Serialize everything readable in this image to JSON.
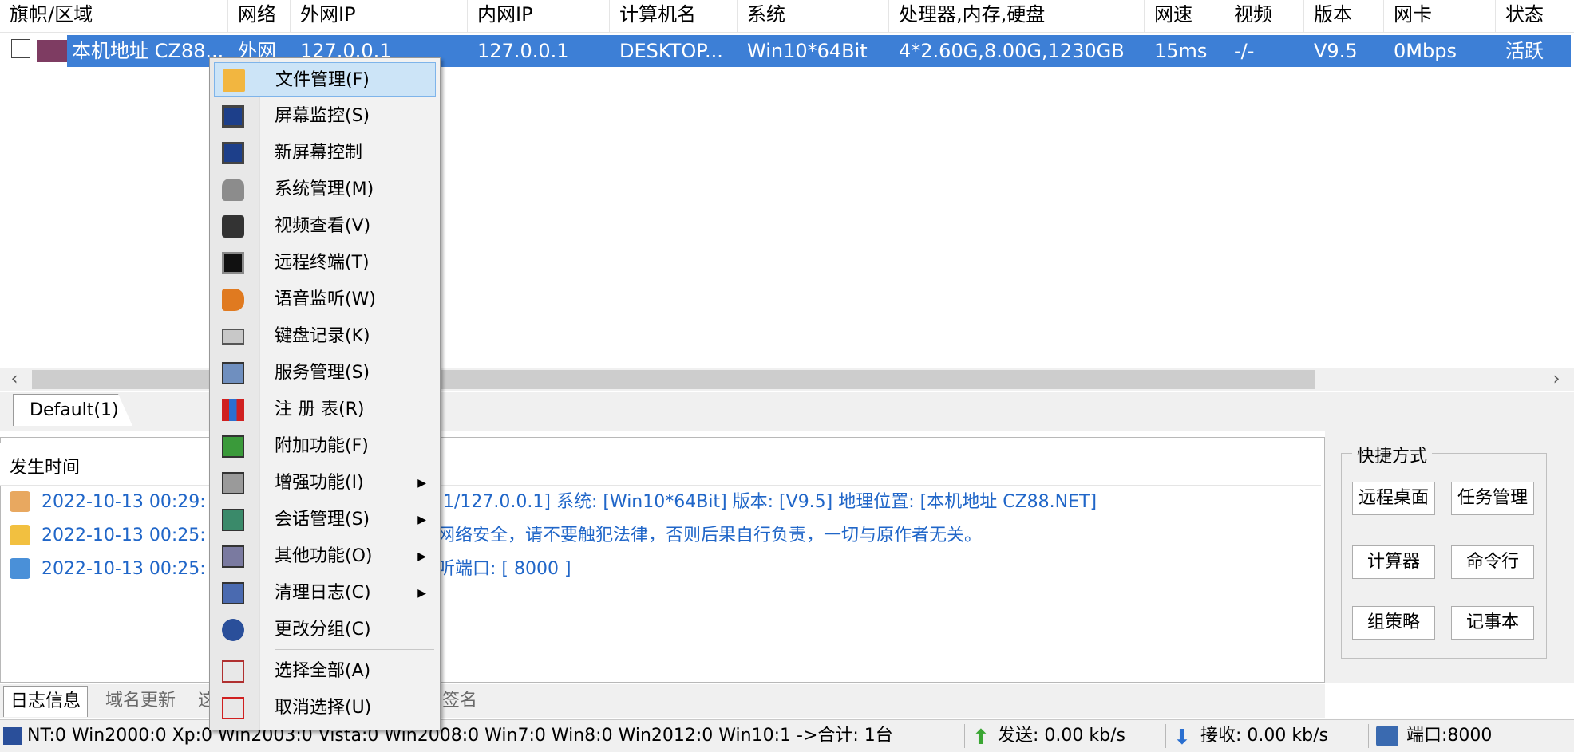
{
  "list": {
    "columns": [
      "旗帜/区域",
      "网络",
      "外网IP",
      "内网IP",
      "计算机名",
      "系统",
      "处理器,内存,硬盘",
      "网速",
      "视频",
      "版本",
      "网卡",
      "状态"
    ],
    "row": {
      "area": "本机地址  CZ88...",
      "network": "外网",
      "wan_ip": "127.0.0.1",
      "lan_ip": "127.0.0.1",
      "computer_name": "DESKTOP...",
      "os": "Win10*64Bit",
      "hardware": "4*2.60G,8.00G,1230GB",
      "speed": "15ms",
      "video": "-/-",
      "version": "V9.5",
      "nic": "0Mbps",
      "status": "活跃"
    }
  },
  "group_tab": "Default(1)",
  "log": {
    "header": "发生时间",
    "rows": [
      {
        "time": "2022-10-13 00:29:",
        "message": ".1/127.0.0.1]   系统: [Win10*64Bit]   版本: [V9.5]   地理位置: [本机地址  CZ88.NET]"
      },
      {
        "time": "2022-10-13 00:25:",
        "message": "网络安全，请不要触犯法律，否则后果自行负责，一切与原作者无关。"
      },
      {
        "time": "2022-10-13 00:25:",
        "message": "听端口: [ 8000 ]"
      }
    ]
  },
  "bottom_tabs": [
    "日志信息",
    "域名更新",
    "这",
    "签名"
  ],
  "shortcuts": {
    "title": "快捷方式",
    "buttons": [
      "远程桌面",
      "任务管理",
      "计算器",
      "命令行",
      "组策略",
      "记事本"
    ]
  },
  "statusbar": {
    "os_counts": "NT:0 Win2000:0 Xp:0 Win2003:0 Vista:0 Win2008:0 Win7:0 Win8:0 Win2012:0 Win10:1 ->合计: 1台",
    "send": "发送: 0.00 kb/s",
    "recv": "接收: 0.00 kb/s",
    "port": "端口:8000"
  },
  "context_menu": {
    "items": [
      {
        "label": "文件管理(F)",
        "icon": "folder-icon"
      },
      {
        "label": "屏幕监控(S)",
        "icon": "monitor-icon"
      },
      {
        "label": "新屏幕控制",
        "icon": "monitor-icon"
      },
      {
        "label": "系统管理(M)",
        "icon": "database-icon"
      },
      {
        "label": "视频查看(V)",
        "icon": "camera-icon"
      },
      {
        "label": "远程终端(T)",
        "icon": "terminal-icon"
      },
      {
        "label": "语音监听(W)",
        "icon": "speaker-icon"
      },
      {
        "label": "键盘记录(K)",
        "icon": "keyboard-icon"
      },
      {
        "label": "服务管理(S)",
        "icon": "services-icon"
      },
      {
        "label": "注 册 表(R)",
        "icon": "registry-icon"
      },
      {
        "label": "附加功能(F)",
        "icon": "plugin-icon"
      },
      {
        "label": "增强功能(I)",
        "icon": "enhance-icon"
      },
      {
        "label": "会话管理(S)",
        "icon": "session-icon"
      },
      {
        "label": "其他功能(O)",
        "icon": "other-icon"
      },
      {
        "label": "清理日志(C)",
        "icon": "clear-log-icon"
      },
      {
        "label": "更改分组(C)",
        "icon": "group-icon"
      },
      {
        "label": "选择全部(A)",
        "icon": "select-all-icon"
      },
      {
        "label": "取消选择(U)",
        "icon": "deselect-icon"
      }
    ]
  },
  "colors": {
    "selection": "#3d7fd6",
    "menu_highlight": "#cce4f7",
    "log_text": "#2066c8"
  }
}
